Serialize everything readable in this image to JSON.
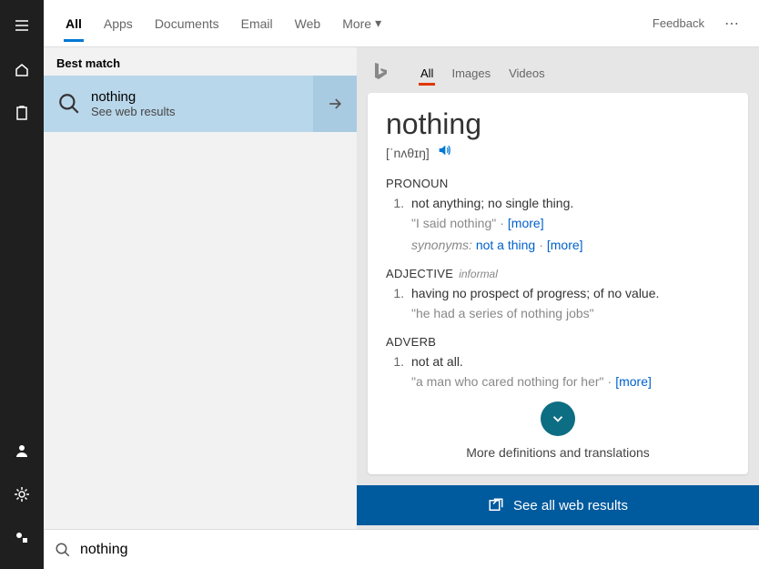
{
  "tabs": {
    "items": [
      "All",
      "Apps",
      "Documents",
      "Email",
      "Web",
      "More"
    ],
    "activeIndex": 0,
    "feedback": "Feedback"
  },
  "left": {
    "bestMatch": "Best match",
    "result": {
      "title": "nothing",
      "subtitle": "See web results"
    }
  },
  "preview": {
    "tabs": [
      "All",
      "Images",
      "Videos"
    ],
    "word": "nothing",
    "pronunciation": "[ˈnʌθɪŋ]",
    "sections": [
      {
        "pos": "PRONOUN",
        "informal": "",
        "num": "1.",
        "def": "not anything; no single thing.",
        "example": "\"I said nothing\"",
        "exampleMore": "[more]",
        "synonymsLabel": "synonyms:",
        "synonyms": "not a thing",
        "synMore": "[more]"
      },
      {
        "pos": "ADJECTIVE",
        "informal": "informal",
        "num": "1.",
        "def": "having no prospect of progress; of no value.",
        "example": "\"he had a series of nothing jobs\"",
        "exampleMore": "",
        "synonymsLabel": "",
        "synonyms": "",
        "synMore": ""
      },
      {
        "pos": "ADVERB",
        "informal": "",
        "num": "1.",
        "def": "not at all.",
        "example": "\"a man who cared nothing for her\"",
        "exampleMore": "[more]",
        "synonymsLabel": "",
        "synonyms": "",
        "synMore": ""
      }
    ],
    "moreDefs": "More definitions and translations",
    "seeAll": "See all web results"
  },
  "search": {
    "value": "nothing"
  }
}
